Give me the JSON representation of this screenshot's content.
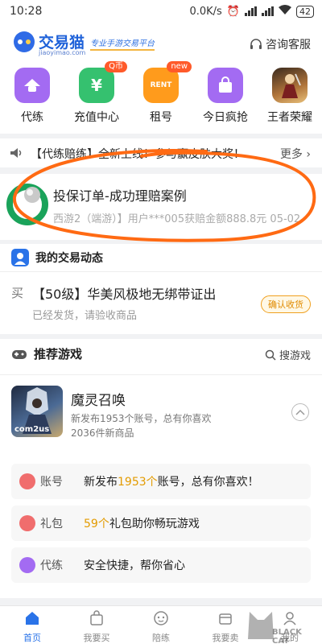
{
  "status_bar": {
    "time": "10:28",
    "network_speed": "0.0K/s",
    "battery": "42"
  },
  "header": {
    "brand": "交易猫",
    "brand_sub": "jiaoyimao.com",
    "slogan": "专业手游交易平台",
    "service_label": "咨询客服"
  },
  "quick_nav": [
    {
      "label": "代练",
      "icon": "hat-icon",
      "color": "#a36bf2"
    },
    {
      "label": "充值中心",
      "icon": "yen-icon",
      "color": "#35c16f",
      "badge": "Q币"
    },
    {
      "label": "租号",
      "icon": "rent-icon",
      "color": "#ff9b1c",
      "badge": "new"
    },
    {
      "label": "今日疯抢",
      "icon": "bag-icon",
      "color": "#a36bf2"
    },
    {
      "label": "王者荣耀",
      "icon": "hero-icon",
      "color": "#b0743a"
    }
  ],
  "notice": {
    "text": "【代练赔练】全新上线！参与赢皮肤大奖！",
    "more": "更多"
  },
  "insurance": {
    "title": "投保订单-成功理赔案例",
    "desc": "西游2（端游）】用户***005获赔金额888.8元 05-02"
  },
  "dynamics": {
    "title": "我的交易动态",
    "tag": "买",
    "order_title": "【50级】华美风极地无绑带证出",
    "order_status": "已经发货，请验收商品",
    "action": "确认收货"
  },
  "recommend": {
    "title": "推荐游戏",
    "search": "搜游戏",
    "game": {
      "name": "魔灵召唤",
      "line1": "新发布1953个账号，总有你喜欢",
      "line2": "2036件新商品",
      "publisher": "com2us"
    },
    "rows": [
      {
        "label": "账号",
        "icon": "account-icon",
        "pre": "新发布",
        "hl": "1953个",
        "post": "账号，总有你喜欢！"
      },
      {
        "label": "礼包",
        "icon": "gift-icon",
        "pre": "",
        "hl": "59个",
        "post": "礼包助你畅玩游戏"
      },
      {
        "label": "代练",
        "icon": "coach-icon",
        "pre": "",
        "hl": "",
        "post": "安全快捷，帮你省心"
      }
    ]
  },
  "tabbar": [
    {
      "label": "首页",
      "icon": "home-icon",
      "active": true
    },
    {
      "label": "我要买",
      "icon": "cart-icon",
      "active": false
    },
    {
      "label": "陪练",
      "icon": "gamepad-icon",
      "active": false
    },
    {
      "label": "我要卖",
      "icon": "sell-icon",
      "active": false
    },
    {
      "label": "我的",
      "icon": "user-icon",
      "active": false
    }
  ],
  "watermark": "BLACK CAT",
  "colors": {
    "accent": "#2a73e8",
    "highlight": "#e39b00",
    "annotation": "#ff6a13"
  }
}
